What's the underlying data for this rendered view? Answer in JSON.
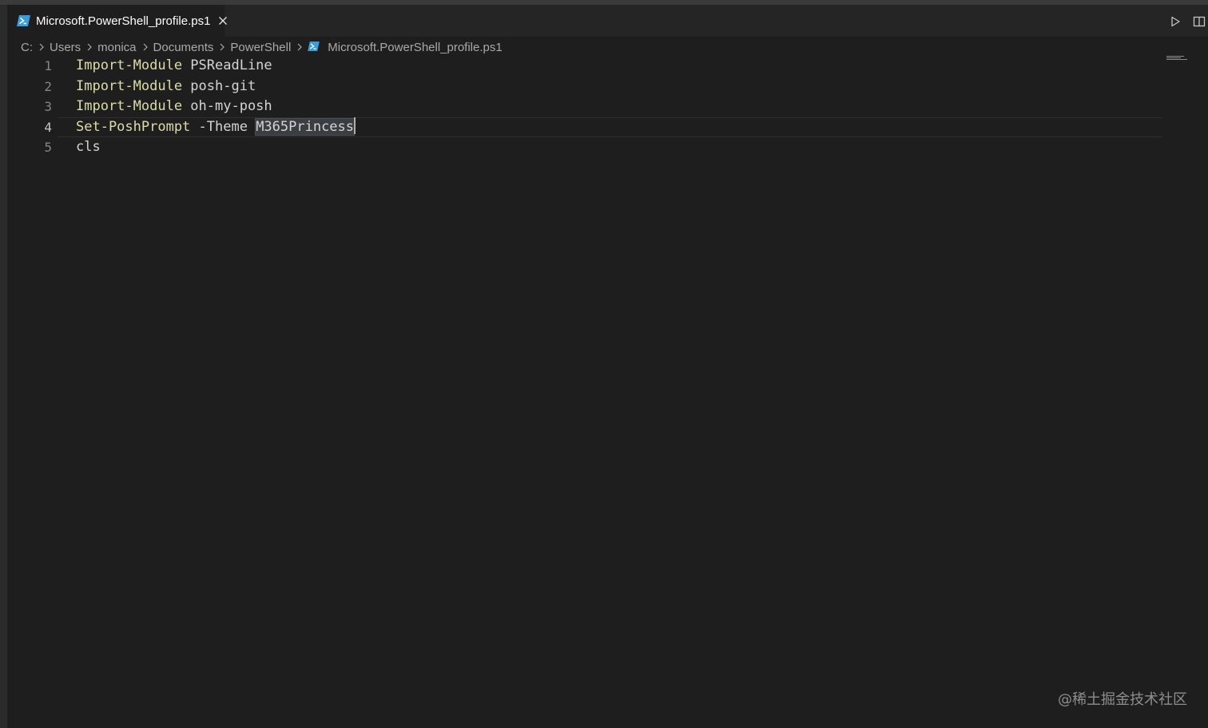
{
  "tab": {
    "title": "Microsoft.PowerShell_profile.ps1",
    "icon": "powershell-icon",
    "close_icon": "close-icon"
  },
  "editor_actions": [
    {
      "name": "run-icon"
    },
    {
      "name": "split-editor-icon"
    }
  ],
  "breadcrumb": {
    "segments": [
      "C:",
      "Users",
      "monica",
      "Documents",
      "PowerShell"
    ],
    "file": "Microsoft.PowerShell_profile.ps1",
    "separator_icon": "chevron-right-icon"
  },
  "editor": {
    "active_line": 4,
    "lines": [
      {
        "number": "1",
        "cmd": "Import-Module",
        "arg": " PSReadLine"
      },
      {
        "number": "2",
        "cmd": "Import-Module",
        "arg": " posh-git"
      },
      {
        "number": "3",
        "cmd": "Import-Module",
        "arg": " oh-my-posh"
      },
      {
        "number": "4",
        "cmd": "Set-PoshPrompt",
        "param": " -Theme ",
        "selected": "M365Princess"
      },
      {
        "number": "5",
        "cmd": "",
        "arg": "cls"
      }
    ]
  },
  "colors": {
    "background": "#1e1e1e",
    "command": "#dcdcaa",
    "text": "#d4d4d4",
    "line_number": "#858585",
    "powershell_icon": "#3c9cd7"
  },
  "watermark": "@稀土掘金技术社区"
}
